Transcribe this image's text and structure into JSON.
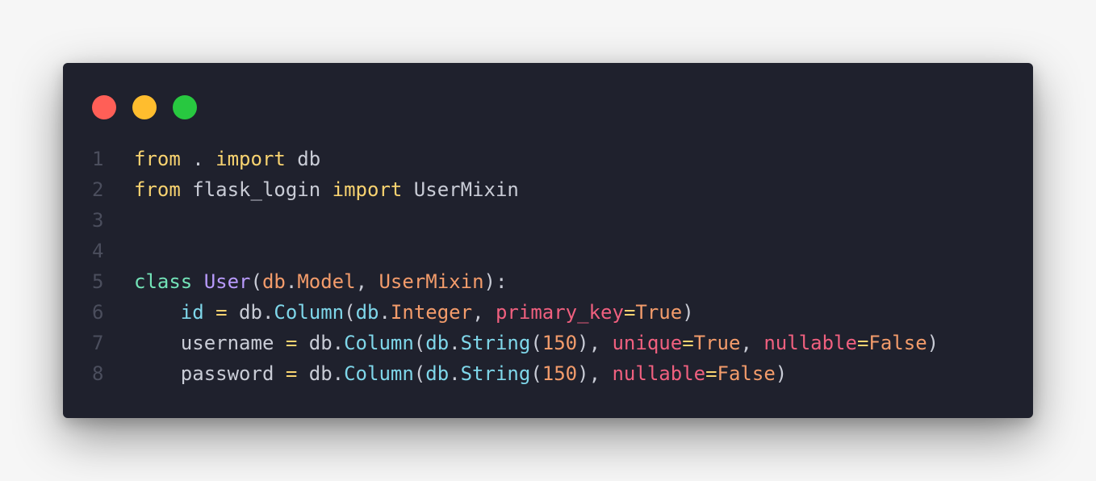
{
  "window": {
    "dots": [
      {
        "name": "close-dot",
        "color": "#ff5f57"
      },
      {
        "name": "minimize-dot",
        "color": "#ffbd2e"
      },
      {
        "name": "maximize-dot",
        "color": "#28c840"
      }
    ]
  },
  "code": {
    "lines": [
      {
        "number": "1",
        "tokens": [
          {
            "text": "from",
            "type": "kw"
          },
          {
            "text": " . ",
            "type": "plain"
          },
          {
            "text": "import",
            "type": "kw"
          },
          {
            "text": " db",
            "type": "plain"
          }
        ]
      },
      {
        "number": "2",
        "tokens": [
          {
            "text": "from",
            "type": "kw"
          },
          {
            "text": " flask_login ",
            "type": "plain"
          },
          {
            "text": "import",
            "type": "kw"
          },
          {
            "text": " UserMixin",
            "type": "plain"
          }
        ]
      },
      {
        "number": "3",
        "tokens": []
      },
      {
        "number": "4",
        "tokens": []
      },
      {
        "number": "5",
        "tokens": [
          {
            "text": "class",
            "type": "def"
          },
          {
            "text": " ",
            "type": "plain"
          },
          {
            "text": "User",
            "type": "cls"
          },
          {
            "text": "(",
            "type": "plain"
          },
          {
            "text": "db",
            "type": "mod"
          },
          {
            "text": ".",
            "type": "plain"
          },
          {
            "text": "Model",
            "type": "mod"
          },
          {
            "text": ", ",
            "type": "plain"
          },
          {
            "text": "UserMixin",
            "type": "mod"
          },
          {
            "text": "):",
            "type": "plain"
          }
        ]
      },
      {
        "number": "6",
        "tokens": [
          {
            "text": "    ",
            "type": "plain"
          },
          {
            "text": "id",
            "type": "attr"
          },
          {
            "text": " ",
            "type": "plain"
          },
          {
            "text": "=",
            "type": "op"
          },
          {
            "text": " db.",
            "type": "plain"
          },
          {
            "text": "Column",
            "type": "attr"
          },
          {
            "text": "(",
            "type": "plain"
          },
          {
            "text": "db",
            "type": "attr"
          },
          {
            "text": ".",
            "type": "plain"
          },
          {
            "text": "Integer",
            "type": "mod"
          },
          {
            "text": ", ",
            "type": "plain"
          },
          {
            "text": "primary_key",
            "type": "kwarg"
          },
          {
            "text": "=",
            "type": "op"
          },
          {
            "text": "True",
            "type": "num"
          },
          {
            "text": ")",
            "type": "plain"
          }
        ]
      },
      {
        "number": "7",
        "tokens": [
          {
            "text": "    username ",
            "type": "plain"
          },
          {
            "text": "=",
            "type": "op"
          },
          {
            "text": " db.",
            "type": "plain"
          },
          {
            "text": "Column",
            "type": "attr"
          },
          {
            "text": "(",
            "type": "plain"
          },
          {
            "text": "db",
            "type": "attr"
          },
          {
            "text": ".",
            "type": "plain"
          },
          {
            "text": "String",
            "type": "attr"
          },
          {
            "text": "(",
            "type": "plain"
          },
          {
            "text": "150",
            "type": "num"
          },
          {
            "text": "), ",
            "type": "plain"
          },
          {
            "text": "unique",
            "type": "kwarg"
          },
          {
            "text": "=",
            "type": "op"
          },
          {
            "text": "True",
            "type": "num"
          },
          {
            "text": ", ",
            "type": "plain"
          },
          {
            "text": "nullable",
            "type": "kwarg"
          },
          {
            "text": "=",
            "type": "op"
          },
          {
            "text": "False",
            "type": "num"
          },
          {
            "text": ")",
            "type": "plain"
          }
        ]
      },
      {
        "number": "8",
        "tokens": [
          {
            "text": "    password ",
            "type": "plain"
          },
          {
            "text": "=",
            "type": "op"
          },
          {
            "text": " db.",
            "type": "plain"
          },
          {
            "text": "Column",
            "type": "attr"
          },
          {
            "text": "(",
            "type": "plain"
          },
          {
            "text": "db",
            "type": "attr"
          },
          {
            "text": ".",
            "type": "plain"
          },
          {
            "text": "String",
            "type": "attr"
          },
          {
            "text": "(",
            "type": "plain"
          },
          {
            "text": "150",
            "type": "num"
          },
          {
            "text": "), ",
            "type": "plain"
          },
          {
            "text": "nullable",
            "type": "kwarg"
          },
          {
            "text": "=",
            "type": "op"
          },
          {
            "text": "False",
            "type": "num"
          },
          {
            "text": ")",
            "type": "plain"
          }
        ]
      }
    ]
  }
}
